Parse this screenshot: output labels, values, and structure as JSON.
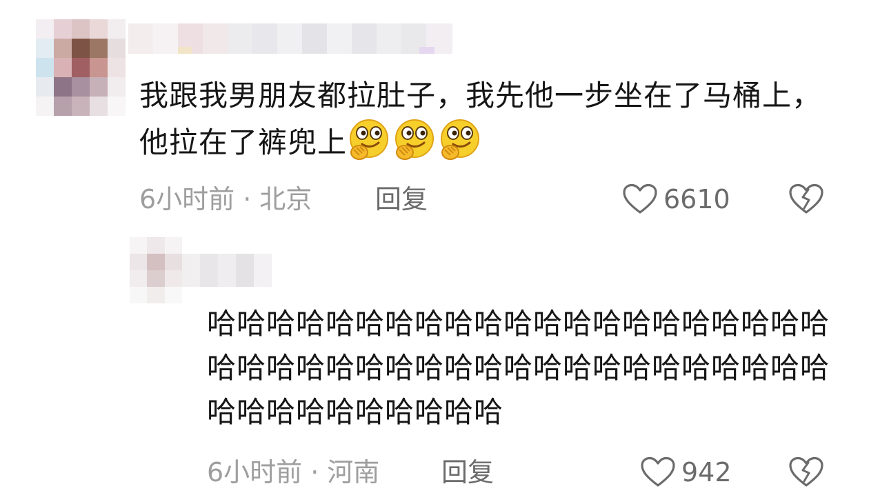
{
  "comments": [
    {
      "text": "我跟我男朋友都拉肚子，我先他一步坐在了马桶上，他拉在了裤兜上",
      "emoji_icons": [
        "grinning-hand-over-mouth-icon",
        "grinning-hand-over-mouth-icon",
        "grinning-hand-over-mouth-icon"
      ],
      "time": "6小时前",
      "separator": "·",
      "location": "北京",
      "reply_label": "回复",
      "like_count": "6610"
    },
    {
      "text": "哈哈哈哈哈哈哈哈哈哈哈哈哈哈哈哈哈哈哈哈哈哈哈哈哈哈哈哈哈哈哈哈哈哈哈哈哈哈哈哈哈哈哈哈哈哈哈哈哈哈哈哈",
      "time": "6小时前",
      "separator": "·",
      "location": "河南",
      "reply_label": "回复",
      "like_count": "942"
    }
  ],
  "colors": {
    "text": "#161616",
    "meta": "#9e9e9e",
    "action": "#6b6b6b",
    "emoji_face": "#f7cf2b"
  }
}
